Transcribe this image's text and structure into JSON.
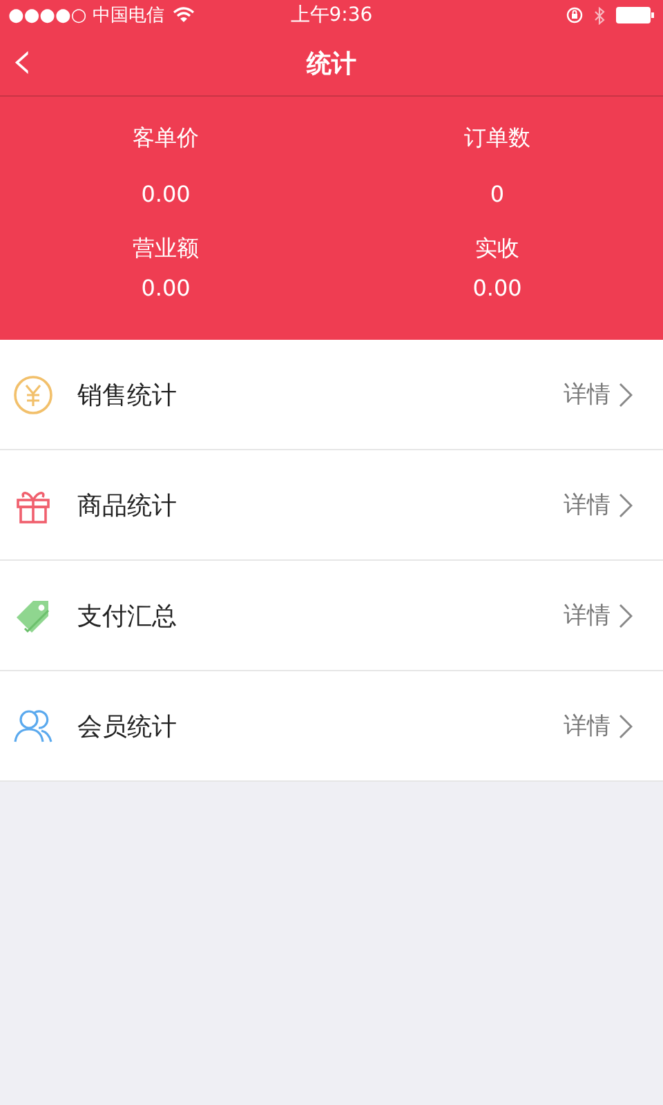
{
  "status_bar": {
    "carrier": "●●●●○ 中国电信",
    "time": "上午9:36"
  },
  "nav": {
    "back": "‹",
    "title": "统计"
  },
  "stats": [
    {
      "label": "客单价",
      "value": "0.00"
    },
    {
      "label": "订单数",
      "value": "0"
    },
    {
      "label": "营业额",
      "value": "0.00"
    },
    {
      "label": "实收",
      "value": "0.00"
    }
  ],
  "menu": [
    {
      "kind": "yen",
      "label": "销售统计",
      "detail": "详情"
    },
    {
      "kind": "gift",
      "label": "商品统计",
      "detail": "详情"
    },
    {
      "kind": "tag",
      "label": "支付汇总",
      "detail": "详情"
    },
    {
      "kind": "people",
      "label": "会员统计",
      "detail": "详情"
    }
  ]
}
